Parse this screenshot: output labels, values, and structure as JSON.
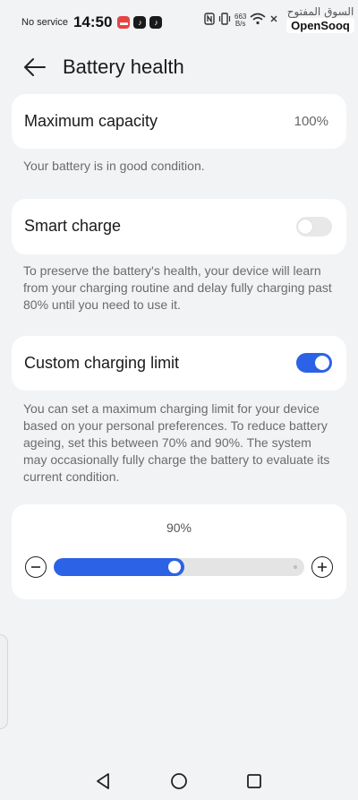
{
  "status_bar": {
    "carrier": "No service",
    "time": "14:50",
    "net_speed_value": "663",
    "net_speed_unit": "B/s",
    "icons": [
      "huawei-app-icon",
      "tiktok-icon",
      "tiktok-icon",
      "nfc-icon",
      "vibrate-icon",
      "wifi-icon",
      "battery-icon"
    ]
  },
  "watermark": {
    "arabic": "السوق المفتوح",
    "english": "OpenSooq"
  },
  "header": {
    "title": "Battery health",
    "back_icon": "arrow-left-icon"
  },
  "max_capacity": {
    "label": "Maximum capacity",
    "value": "100%",
    "description": "Your battery is in good condition."
  },
  "smart_charge": {
    "label": "Smart charge",
    "enabled": false,
    "description": "To preserve the battery's health, your device will learn from your charging routine and delay fully charging past 80% until you need to use it."
  },
  "custom_limit": {
    "label": "Custom charging limit",
    "enabled": true,
    "description": "You can set a maximum charging limit for your device based on your personal preferences. To reduce battery ageing, set this between 70% and 90%. The system may occasionally fully charge the battery to evaluate its current condition."
  },
  "limit_slider": {
    "value_label": "90%",
    "value": 90,
    "min": 70,
    "max": 100
  },
  "nav_bar": {
    "icons": [
      "back-triangle-icon",
      "home-circle-icon",
      "recents-square-icon"
    ]
  },
  "colors": {
    "accent": "#2c62e6",
    "background": "#f1f3f5",
    "card": "#ffffff"
  }
}
